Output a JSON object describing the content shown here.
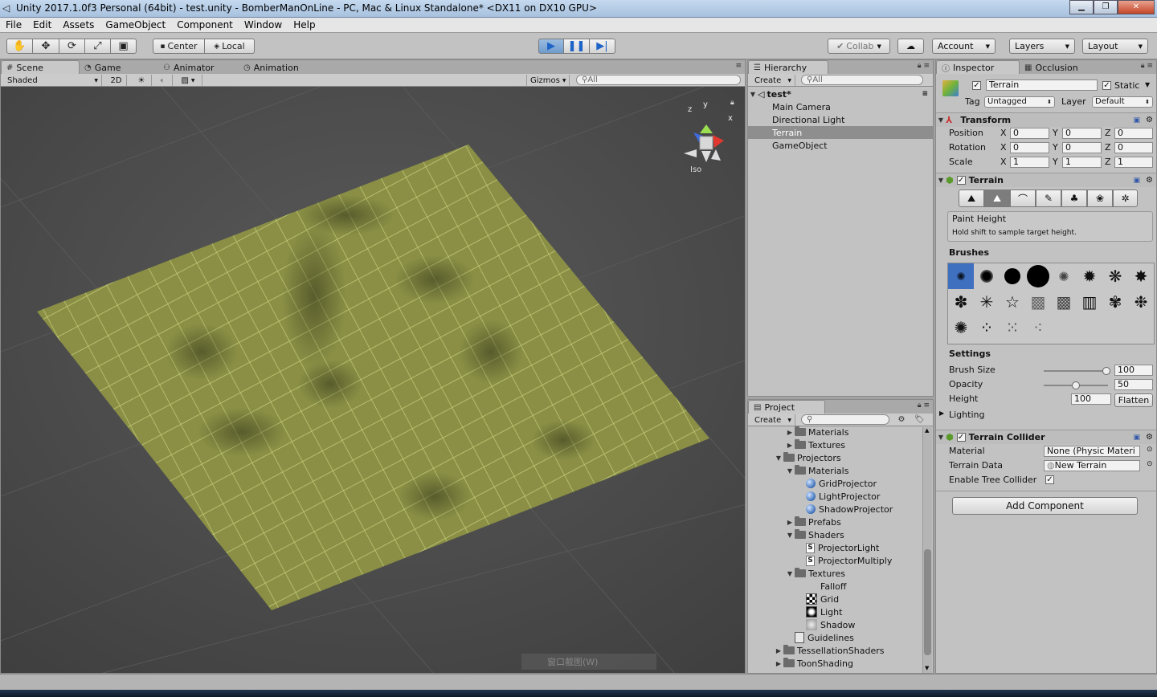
{
  "window": {
    "title": "Unity 2017.1.0f3 Personal (64bit) - test.unity - BomberManOnLine - PC, Mac & Linux Standalone* <DX11 on DX10 GPU>",
    "min": "▁",
    "max": "❐",
    "close": "✕"
  },
  "menu": [
    "File",
    "Edit",
    "Assets",
    "GameObject",
    "Component",
    "Window",
    "Help"
  ],
  "toolbar": {
    "center": "Center",
    "local": "Local",
    "collab": "Collab",
    "account": "Account",
    "layers": "Layers",
    "layout": "Layout"
  },
  "scene": {
    "tabs": [
      "Scene",
      "Game",
      "Animator",
      "Animation"
    ],
    "shading": "Shaded",
    "mode2d": "2D",
    "gizmos": "Gizmos",
    "search_placeholder": "All",
    "iso": "Iso",
    "axis_x": "x",
    "axis_y": "y",
    "axis_z": "z",
    "watermark": "窗口截图(W)"
  },
  "hierarchy": {
    "tab": "Hierarchy",
    "create": "Create",
    "search_placeholder": "All",
    "scene_name": "test*",
    "items": [
      "Main Camera",
      "Directional Light",
      "Terrain",
      "GameObject"
    ]
  },
  "project": {
    "tab": "Project",
    "create": "Create",
    "items": [
      {
        "label": "Materials",
        "type": "folder",
        "indent": 3,
        "arrow": "▶"
      },
      {
        "label": "Textures",
        "type": "folder",
        "indent": 3,
        "arrow": "▶"
      },
      {
        "label": "Projectors",
        "type": "folder",
        "indent": 2,
        "arrow": "▼"
      },
      {
        "label": "Materials",
        "type": "folder",
        "indent": 3,
        "arrow": "▼"
      },
      {
        "label": "GridProjector",
        "type": "material",
        "indent": 4,
        "arrow": ""
      },
      {
        "label": "LightProjector",
        "type": "material",
        "indent": 4,
        "arrow": ""
      },
      {
        "label": "ShadowProjector",
        "type": "material",
        "indent": 4,
        "arrow": ""
      },
      {
        "label": "Prefabs",
        "type": "folder",
        "indent": 3,
        "arrow": "▶"
      },
      {
        "label": "Shaders",
        "type": "folder",
        "indent": 3,
        "arrow": "▼"
      },
      {
        "label": "ProjectorLight",
        "type": "shader",
        "indent": 4,
        "arrow": ""
      },
      {
        "label": "ProjectorMultiply",
        "type": "shader",
        "indent": 4,
        "arrow": ""
      },
      {
        "label": "Textures",
        "type": "folder",
        "indent": 3,
        "arrow": "▼"
      },
      {
        "label": "Falloff",
        "type": "none",
        "indent": 4,
        "arrow": ""
      },
      {
        "label": "Grid",
        "type": "grid",
        "indent": 4,
        "arrow": ""
      },
      {
        "label": "Light",
        "type": "light",
        "indent": 4,
        "arrow": ""
      },
      {
        "label": "Shadow",
        "type": "shadow",
        "indent": 4,
        "arrow": ""
      },
      {
        "label": "Guidelines",
        "type": "doc",
        "indent": 3,
        "arrow": ""
      },
      {
        "label": "TessellationShaders",
        "type": "folder",
        "indent": 2,
        "arrow": "▶"
      },
      {
        "label": "ToonShading",
        "type": "folder",
        "indent": 2,
        "arrow": "▶"
      }
    ]
  },
  "inspector": {
    "tab": "Inspector",
    "tab2": "Occlusion",
    "object_name": "Terrain",
    "static_label": "Static",
    "tag_label": "Tag",
    "tag_value": "Untagged",
    "layer_label": "Layer",
    "layer_value": "Default",
    "transform": {
      "title": "Transform",
      "rows": [
        {
          "label": "Position",
          "x": "0",
          "y": "0",
          "z": "0"
        },
        {
          "label": "Rotation",
          "x": "0",
          "y": "0",
          "z": "0"
        },
        {
          "label": "Scale",
          "x": "1",
          "y": "1",
          "z": "1"
        }
      ],
      "x_label": "X",
      "y_label": "Y",
      "z_label": "Z"
    },
    "terrain": {
      "title": "Terrain",
      "mode_title": "Paint Height",
      "mode_hint": "Hold shift to sample target height.",
      "brushes_label": "Brushes",
      "settings_label": "Settings",
      "brush_size_label": "Brush Size",
      "brush_size_value": "100",
      "brush_size_level": 0.98,
      "opacity_label": "Opacity",
      "opacity_value": "50",
      "opacity_level": 0.5,
      "height_label": "Height",
      "height_value": "100",
      "flatten_label": "Flatten",
      "lighting_label": "Lighting"
    },
    "collider": {
      "title": "Terrain Collider",
      "material_label": "Material",
      "material_value": "None (Physic Materi",
      "data_label": "Terrain Data",
      "data_value": "New Terrain",
      "tree_label": "Enable Tree Collider"
    },
    "add_component": "Add Component"
  },
  "colors": {
    "terrain": "#8a8f45",
    "selection": "#8e8e8e",
    "accent": "#1e64c8"
  }
}
